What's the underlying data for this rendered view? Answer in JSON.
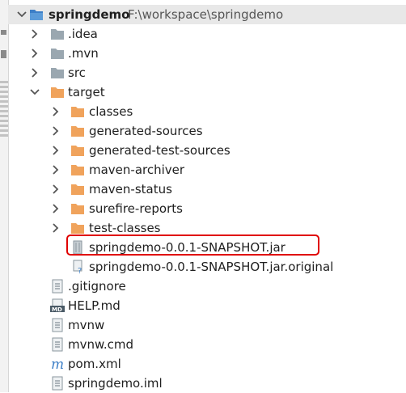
{
  "tree": {
    "root": {
      "name": "springdemo",
      "path": "F:\\workspace\\springdemo"
    },
    "items": [
      {
        "label": "idea",
        "display": ".idea"
      },
      {
        "label": "mvn",
        "display": ".mvn"
      },
      {
        "label": "src",
        "display": "src"
      },
      {
        "label": "target",
        "display": "target"
      },
      {
        "label": "classes",
        "display": "classes"
      },
      {
        "label": "generated-sources",
        "display": "generated-sources"
      },
      {
        "label": "generated-test-sources",
        "display": "generated-test-sources"
      },
      {
        "label": "maven-archiver",
        "display": "maven-archiver"
      },
      {
        "label": "maven-status",
        "display": "maven-status"
      },
      {
        "label": "surefire-reports",
        "display": "surefire-reports"
      },
      {
        "label": "test-classes",
        "display": "test-classes"
      },
      {
        "label": "jar",
        "display": "springdemo-0.0.1-SNAPSHOT.jar"
      },
      {
        "label": "jar-original",
        "display": "springdemo-0.0.1-SNAPSHOT.jar.original"
      },
      {
        "label": "gitignore",
        "display": ".gitignore"
      },
      {
        "label": "help",
        "display": "HELP.md"
      },
      {
        "label": "mvnw",
        "display": "mvnw"
      },
      {
        "label": "mvnw-cmd",
        "display": "mvnw.cmd"
      },
      {
        "label": "pom",
        "display": "pom.xml"
      },
      {
        "label": "iml",
        "display": "springdemo.iml"
      }
    ]
  },
  "colors": {
    "folder_gray": "#9aa7b0",
    "folder_orange": "#f0a35c",
    "module_blue": "#3d7fc7",
    "highlight": "#e00000"
  }
}
